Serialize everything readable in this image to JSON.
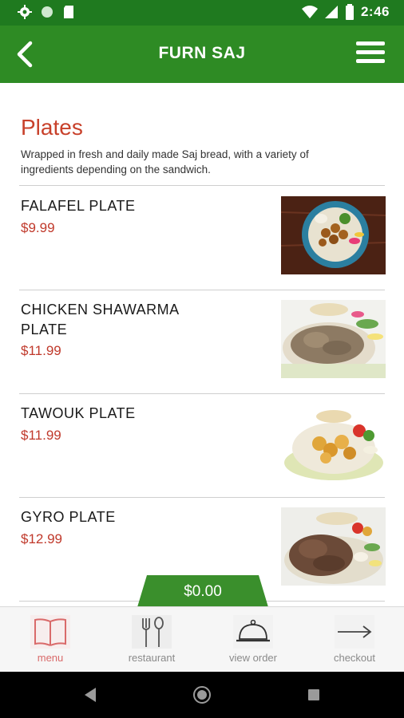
{
  "status_bar": {
    "time": "2:46",
    "icons": [
      "settings-icon",
      "circle-icon",
      "sd-card-icon",
      "wifi-icon",
      "signal-icon",
      "battery-icon"
    ]
  },
  "app_bar": {
    "title": "FURN SAJ",
    "back_icon": "back-arrow-icon",
    "menu_icon": "hamburger-menu-icon"
  },
  "section": {
    "title": "Plates",
    "description": "Wrapped in fresh and daily made Saj bread, with a variety of ingredients depending on the sandwich."
  },
  "items": [
    {
      "name": "FALAFEL PLATE",
      "price": "$9.99"
    },
    {
      "name": "CHICKEN SHAWARMA PLATE",
      "price": "$11.99"
    },
    {
      "name": "TAWOUK PLATE",
      "price": "$11.99"
    },
    {
      "name": "GYRO PLATE",
      "price": "$12.99"
    }
  ],
  "cart": {
    "total": "$0.00"
  },
  "bottom_nav": [
    {
      "label": "menu",
      "icon": "book-icon",
      "active": true
    },
    {
      "label": "restaurant",
      "icon": "fork-spoon-icon",
      "active": false
    },
    {
      "label": "view order",
      "icon": "cloche-icon",
      "active": false
    },
    {
      "label": "checkout",
      "icon": "arrow-right-icon",
      "active": false
    }
  ],
  "system_nav": {
    "icons": [
      "back-triangle-icon",
      "home-circle-icon",
      "recents-square-icon"
    ]
  },
  "colors": {
    "status_bar": "#1f7a1f",
    "app_bar": "#2e8b24",
    "section_title": "#c8412b",
    "price": "#c0392b",
    "cart_tab": "#3a8f2c",
    "nav_active": "#d96a6a"
  }
}
